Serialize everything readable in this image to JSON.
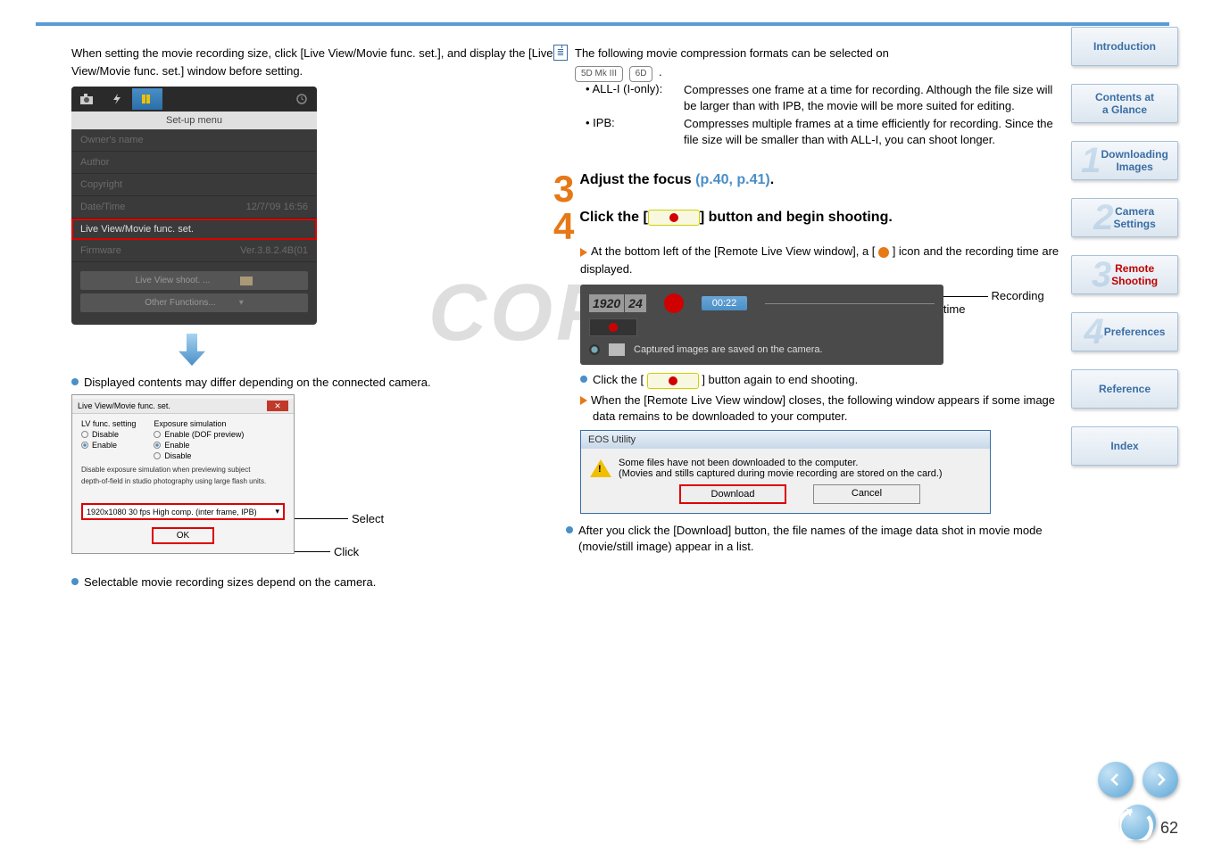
{
  "left": {
    "intro": "When setting the movie recording size, click [Live View/Movie func. set.], and display the [Live View/Movie func. set.] window before setting.",
    "menu": {
      "header": "Set-up menu",
      "rows": [
        {
          "l": "Owner's name",
          "r": ""
        },
        {
          "l": "Author",
          "r": ""
        },
        {
          "l": "Copyright",
          "r": ""
        },
        {
          "l": "Date/Time",
          "r": "12/7/'09 16:56"
        },
        {
          "l": "Live View/Movie func. set.",
          "r": "",
          "hl": true
        },
        {
          "l": "Firmware",
          "r": "Ver.3.8.2.4B(01"
        }
      ],
      "btn1": "Live View shoot. ...",
      "btn2": "Other Functions..."
    },
    "displayed_note": "Displayed contents may differ depending on the connected camera.",
    "dialog": {
      "title": "Live View/Movie func. set.",
      "lv_label": "LV func. setting",
      "exp_label": "Exposure simulation",
      "disable": "Disable",
      "enable": "Enable",
      "enable_dof": "Enable (DOF preview)",
      "note1": "Disable exposure simulation when previewing subject",
      "note2": "depth-of-field in studio photography using large flash units.",
      "select_val": "1920x1080 30 fps High comp. (inter frame, IPB)",
      "ok": "OK"
    },
    "callout_select": "Select",
    "callout_click": "Click",
    "selectable_note": "Selectable movie recording sizes depend on the camera."
  },
  "right": {
    "compression_intro": "The following movie compression formats can be selected on ",
    "models": [
      "5D Mk III",
      "6D"
    ],
    "codecs": [
      {
        "label": "• ALL-I (I-only):",
        "desc": "Compresses one frame at a time for recording. Although the file size will be larger than with IPB, the movie will be more suited for editing."
      },
      {
        "label": "• IPB:",
        "desc": "Compresses multiple frames at a time efficiently for recording. Since the file size will be smaller than with ALL-I, you can shoot longer."
      }
    ],
    "step3": {
      "title_a": "Adjust the focus ",
      "link": "(p.40, p.41)",
      "title_b": "."
    },
    "step4": {
      "title_a": "Click the [",
      "title_b": "] button and begin shooting.",
      "line1": "At the bottom left of the [Remote Live View window], a [",
      "line1b": "] icon and the recording time are displayed.",
      "rec_res": "1920",
      "rec_fps": "24",
      "rec_time": "00:22",
      "rec_caption": "Captured images are saved on the camera.",
      "rec_time_label": "Recording time",
      "line2a": "Click the [",
      "line2b": "] button again to end shooting.",
      "line3": "When the [Remote Live View window] closes, the following window appears if some image data remains to be downloaded to your computer."
    },
    "eos": {
      "title": "EOS Utility",
      "msg1": "Some files have not been downloaded to the computer.",
      "msg2": "(Movies and stills captured during movie recording are stored on the card.)",
      "download": "Download",
      "cancel": "Cancel"
    },
    "after_note": "After you click the [Download] button, the file names of the image data shot in movie mode (movie/still image) appear in a list."
  },
  "sidebar": {
    "items": [
      {
        "label": "Introduction"
      },
      {
        "label": "Contents at a Glance"
      },
      {
        "label": "Downloading Images",
        "num": "1"
      },
      {
        "label": "Camera Settings",
        "num": "2"
      },
      {
        "label": "Remote Shooting",
        "num": "3",
        "active": true
      },
      {
        "label": "Preferences",
        "num": "4"
      },
      {
        "label": "Reference"
      },
      {
        "label": "Index"
      }
    ]
  },
  "page": "62",
  "watermark": "COPY"
}
